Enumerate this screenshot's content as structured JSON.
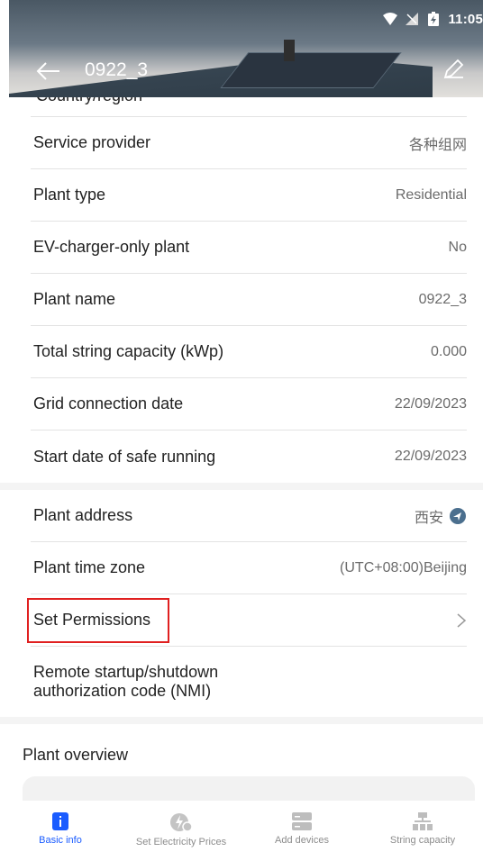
{
  "status": {
    "time": "11:05"
  },
  "header": {
    "title": "0922_3"
  },
  "clipped_row": {
    "label": "Country/region"
  },
  "rows": [
    {
      "label": "Service provider",
      "value": "各种组网"
    },
    {
      "label": "Plant type",
      "value": "Residential"
    },
    {
      "label": "EV-charger-only plant",
      "value": "No"
    },
    {
      "label": "Plant name",
      "value": "0922_3"
    },
    {
      "label": "Total string capacity (kWp)",
      "value": "0.000"
    },
    {
      "label": "Grid connection date",
      "value": "22/09/2023"
    },
    {
      "label": "Start date of safe running",
      "value": "22/09/2023"
    }
  ],
  "rows2": [
    {
      "label": "Plant address",
      "value": "西安"
    },
    {
      "label": "Plant time zone",
      "value": "(UTC+08:00)Beijing"
    },
    {
      "label": "Set Permissions",
      "value": ""
    },
    {
      "label_line1": "Remote startup/shutdown",
      "label_line2": "authorization code (NMI)"
    }
  ],
  "overview": {
    "title": "Plant overview"
  },
  "nav": [
    {
      "label": "Basic info"
    },
    {
      "label": "Set Electricity Prices"
    },
    {
      "label": "Add devices"
    },
    {
      "label": "String capacity"
    }
  ],
  "colors": {
    "accent": "#1a5cff",
    "highlight": "#e02020"
  }
}
